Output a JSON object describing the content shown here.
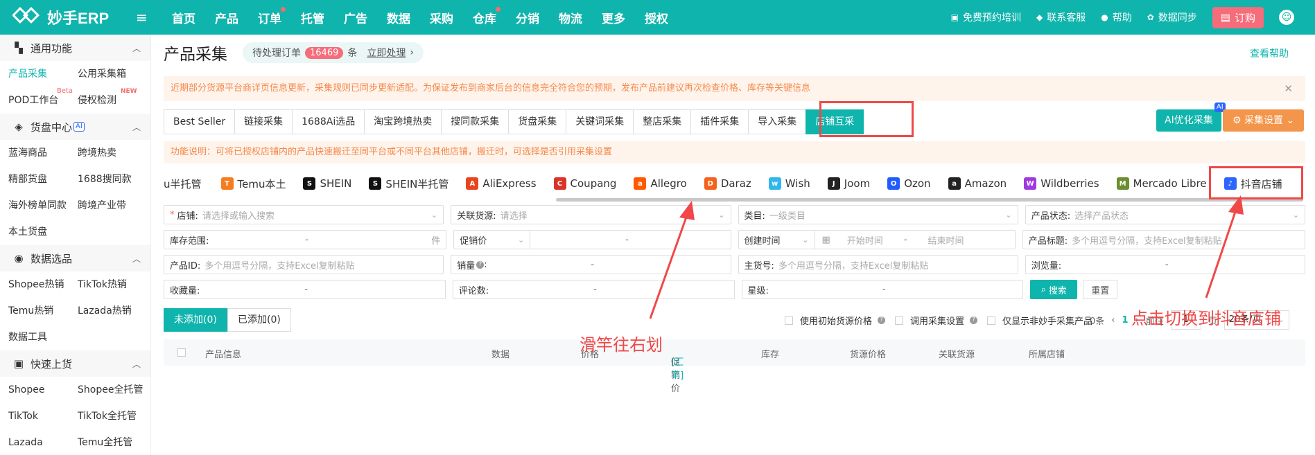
{
  "topbar": {
    "logo_text": "妙手ERP",
    "nav": [
      {
        "label": "首页",
        "dot": false
      },
      {
        "label": "产品",
        "dot": false
      },
      {
        "label": "订单",
        "dot": true
      },
      {
        "label": "托管",
        "dot": false
      },
      {
        "label": "广告",
        "dot": false
      },
      {
        "label": "数据",
        "dot": false
      },
      {
        "label": "采购",
        "dot": false
      },
      {
        "label": "仓库",
        "dot": true
      },
      {
        "label": "分销",
        "dot": false
      },
      {
        "label": "物流",
        "dot": false
      },
      {
        "label": "更多",
        "dot": false
      },
      {
        "label": "授权",
        "dot": false
      }
    ],
    "right_links": {
      "training": "免费预约培训",
      "support": "联系客服",
      "help": "帮助",
      "sync": "数据同步",
      "order": "订购"
    },
    "accent_color": "#0fb4ad"
  },
  "sidebar": {
    "groups": [
      {
        "title": "通用功能",
        "icon": "grid-icon",
        "items": [
          {
            "label": "产品采集",
            "active": true
          },
          {
            "label": "公用采集箱",
            "active": false
          },
          {
            "label": "POD工作台",
            "badge": "Beta"
          },
          {
            "label": "侵权检测",
            "badge": "NEW"
          }
        ]
      },
      {
        "title": "货盘中心",
        "icon": "box-icon",
        "ai": "AI",
        "items": [
          {
            "label": "蓝海商品"
          },
          {
            "label": "跨境热卖"
          },
          {
            "label": "精部货盘"
          },
          {
            "label": "1688搜同款"
          },
          {
            "label": "海外榜单同款"
          },
          {
            "label": "跨境产业带"
          },
          {
            "label": "本土货盘"
          }
        ]
      },
      {
        "title": "数据选品",
        "icon": "fire-icon",
        "items": [
          {
            "label": "Shopee热销"
          },
          {
            "label": "TikTok热销"
          },
          {
            "label": "Temu热销"
          },
          {
            "label": "Lazada热销"
          },
          {
            "label": "数据工具"
          }
        ]
      },
      {
        "title": "快速上货",
        "icon": "bag-icon",
        "items": [
          {
            "label": "Shopee"
          },
          {
            "label": "Shopee全托管"
          },
          {
            "label": "TikTok"
          },
          {
            "label": "TikTok全托管"
          },
          {
            "label": "Lazada"
          },
          {
            "label": "Temu全托管"
          }
        ]
      }
    ]
  },
  "main": {
    "title": "产品采集",
    "pending": {
      "label": "待处理订单",
      "count": "16469",
      "unit": "条",
      "action": "立即处理"
    },
    "help": "查看帮助",
    "notice": "近期部分货源平台商详页信息更新，采集规则已同步更新适配。为保证发布到商家后台的信息完全符合您的预期，发布产品前建议再次检查价格、库存等关键信息",
    "tabs": [
      "Best Seller",
      "链接采集",
      "1688Ai选品",
      "淘宝跨境热卖",
      "搜同款采集",
      "货盘采集",
      "关键词采集",
      "整店采集",
      "插件采集",
      "导入采集",
      "店铺互采"
    ],
    "active_tab": "店铺互采",
    "ai_optimize": "AI优化采集",
    "ai_tag": "AI",
    "collect_settings": "采集设置",
    "func_desc": "功能说明：可将已授权店铺内的产品快速搬迁至同平台或不同平台其他店铺，搬迁时，可选择是否引用采集设置",
    "platforms": [
      {
        "label": "u半托管",
        "icon": ""
      },
      {
        "label": "Temu本土",
        "icon": "temu-icon",
        "color": "#f57c1f"
      },
      {
        "label": "SHEIN",
        "icon": "shein-icon",
        "color": "#111111"
      },
      {
        "label": "SHEIN半托管",
        "icon": "shein-icon",
        "color": "#111111"
      },
      {
        "label": "AliExpress",
        "icon": "aliexpress-icon",
        "color": "#e8451f"
      },
      {
        "label": "Coupang",
        "icon": "coupang-icon",
        "color": "#d8342b"
      },
      {
        "label": "Allegro",
        "icon": "allegro-icon",
        "color": "#ff5a00"
      },
      {
        "label": "Daraz",
        "icon": "daraz-icon",
        "color": "#f4631e"
      },
      {
        "label": "Wish",
        "icon": "wish-icon",
        "color": "#2fb7ec"
      },
      {
        "label": "Joom",
        "icon": "joom-icon",
        "color": "#222222"
      },
      {
        "label": "Ozon",
        "icon": "ozon-icon",
        "color": "#1f5bff"
      },
      {
        "label": "Amazon",
        "icon": "amazon-icon",
        "color": "#222222"
      },
      {
        "label": "Wildberries",
        "icon": "wildberries-icon",
        "color": "#a03ae0"
      },
      {
        "label": "Mercado Libre",
        "icon": "mercado-icon",
        "color": "#6b8e2e"
      },
      {
        "label": "抖音店铺",
        "icon": "douyin-icon",
        "color": "#2c66ff"
      }
    ],
    "filters": {
      "store_label": "店铺:",
      "store_ph": "请选择或输入搜索",
      "source_label": "关联货源:",
      "source_ph": "请选择",
      "category_label": "类目:",
      "category_ph": "一级类目",
      "status_label": "产品状态:",
      "status_ph": "选择产品状态",
      "stock_label": "库存范围:",
      "stock_unit": "件",
      "promo_label": "促销价",
      "create_label": "创建时间",
      "start_ph": "开始时间",
      "end_ph": "结束时间",
      "ptitle_label": "产品标题:",
      "ptitle_ph": "多个用逗号分隔，支持Excel复制粘贴",
      "pid_label": "产品ID:",
      "pid_ph": "多个用逗号分隔，支持Excel复制粘贴",
      "sales_label": "销量",
      "sku_label": "主货号:",
      "sku_ph": "多个用逗号分隔，支持Excel复制粘贴",
      "views_label": "浏览量:",
      "fav_label": "收藏量:",
      "reviews_label": "评论数:",
      "rating_label": "星级:",
      "search": "搜索",
      "reset": "重置",
      "dash": "-"
    },
    "result_tabs": {
      "not_added": "未添加(0)",
      "added": "已添加(0)"
    },
    "options": {
      "orig_price": "使用初始货源价格",
      "use_settings": "调用采集设置",
      "only_non": "仅显示非妙手采集产品"
    },
    "pager": {
      "total": "0条",
      "current": "1",
      "goto": "前往",
      "page_input": "1",
      "page_unit": "页",
      "size": "20条/页"
    },
    "table_headers": [
      "产品信息",
      "数据",
      "价格",
      "促销价",
      "[汇率]",
      "库存",
      "货源价格",
      "关联货源",
      "所属店铺"
    ]
  },
  "annotations": {
    "scroll_hint": "滑竿往右划",
    "switch_hint": "点击切换到抖音店铺",
    "color": "#f04848"
  }
}
